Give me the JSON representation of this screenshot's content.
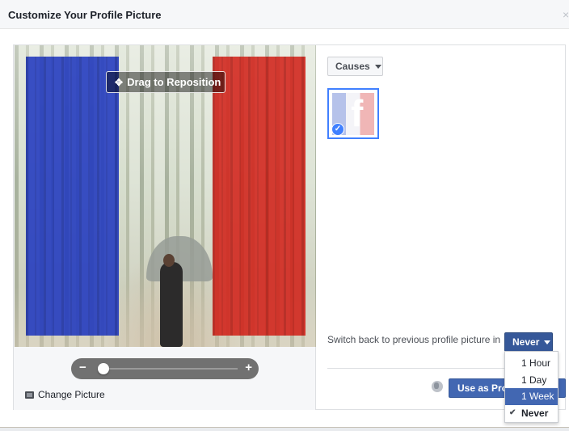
{
  "dialog": {
    "title": "Customize Your Profile Picture",
    "close_label": "×"
  },
  "editor": {
    "drag_label": "Drag to Reposition",
    "zoom_minus": "−",
    "zoom_plus": "+",
    "zoom_level": 0.05,
    "change_picture_label": "Change Picture"
  },
  "sidebar": {
    "causes_label": "Causes",
    "selected_frame_icon": "facebook-f-tricolor",
    "switch_back_label": "Switch back to previous profile picture in",
    "duration_selected": "Never",
    "use_button_label": "Use as Profile Picture",
    "privacy_icon": "globe-icon"
  },
  "duration_menu": {
    "options": [
      "1 Hour",
      "1 Day",
      "1 Week",
      "Never"
    ],
    "highlighted": "1 Week",
    "checked": "Never"
  },
  "colors": {
    "accent_blue": "#4267b2",
    "flag_blue": "#2038be",
    "flag_red": "#d21e16"
  }
}
